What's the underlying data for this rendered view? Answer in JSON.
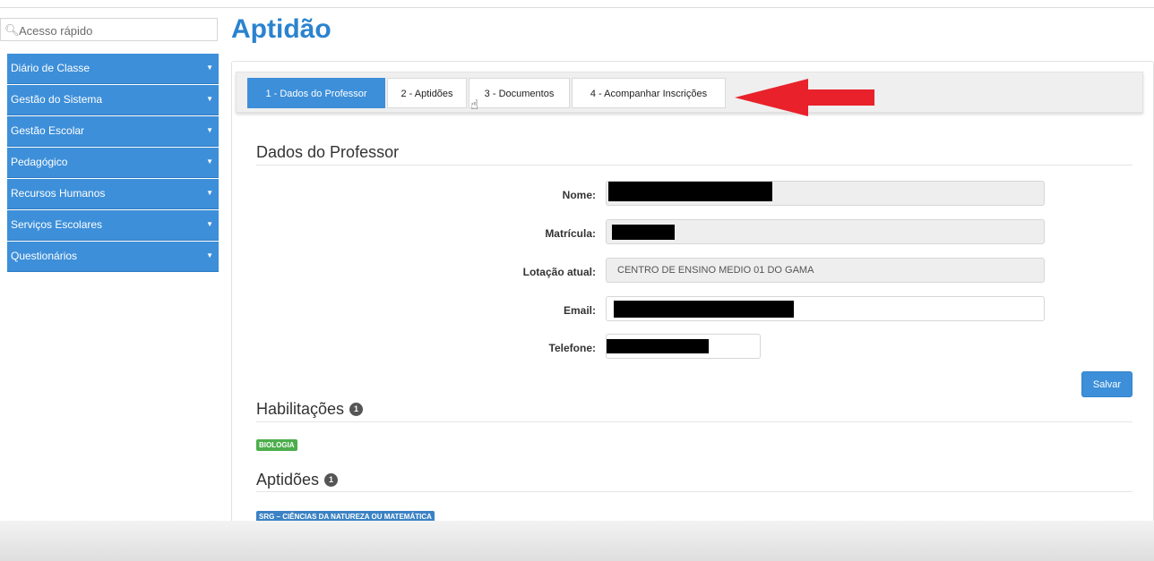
{
  "sidebar": {
    "search_placeholder": "Acesso rápido",
    "menu": [
      {
        "label": "Diário de Classe"
      },
      {
        "label": "Gestão do Sistema"
      },
      {
        "label": "Gestão Escolar"
      },
      {
        "label": "Pedagógico"
      },
      {
        "label": "Recursos Humanos"
      },
      {
        "label": "Serviços Escolares"
      },
      {
        "label": "Questionários"
      }
    ]
  },
  "page": {
    "title": "Aptidão"
  },
  "tabs": [
    {
      "label": "1 - Dados do Professor",
      "active": true
    },
    {
      "label": "2 - Aptidões",
      "active": false
    },
    {
      "label": "3 - Documentos",
      "active": false
    },
    {
      "label": "4 - Acompanhar Inscrições",
      "active": false
    }
  ],
  "professor": {
    "section_title": "Dados do Professor",
    "fields": {
      "nome": {
        "label": "Nome:",
        "value": ""
      },
      "matricula": {
        "label": "Matrícula:",
        "value": ""
      },
      "lotacao": {
        "label": "Lotação atual:",
        "value": "CENTRO DE ENSINO MEDIO 01 DO GAMA"
      },
      "email": {
        "label": "Email:",
        "value": ""
      },
      "telefone": {
        "label": "Telefone:",
        "value": ""
      }
    },
    "save_label": "Salvar"
  },
  "habilitacoes": {
    "title": "Habilitações",
    "count": "1",
    "items": [
      "BIOLOGIA"
    ]
  },
  "aptidoes": {
    "title": "Aptidões",
    "count": "1",
    "items": [
      "SRG – CIÊNCIAS DA NATUREZA OU MATEMÁTICA"
    ]
  },
  "colors": {
    "accent": "#3d8fd9",
    "title": "#2a83cf",
    "badge_green": "#4cae4c",
    "badge_blue": "#3b82c4",
    "annotation_arrow": "#e8212b"
  },
  "icons": {
    "search": "search-icon",
    "caret": "caret-down-icon",
    "pointer": "hand-pointer-icon",
    "arrow": "red-arrow-annotation"
  }
}
